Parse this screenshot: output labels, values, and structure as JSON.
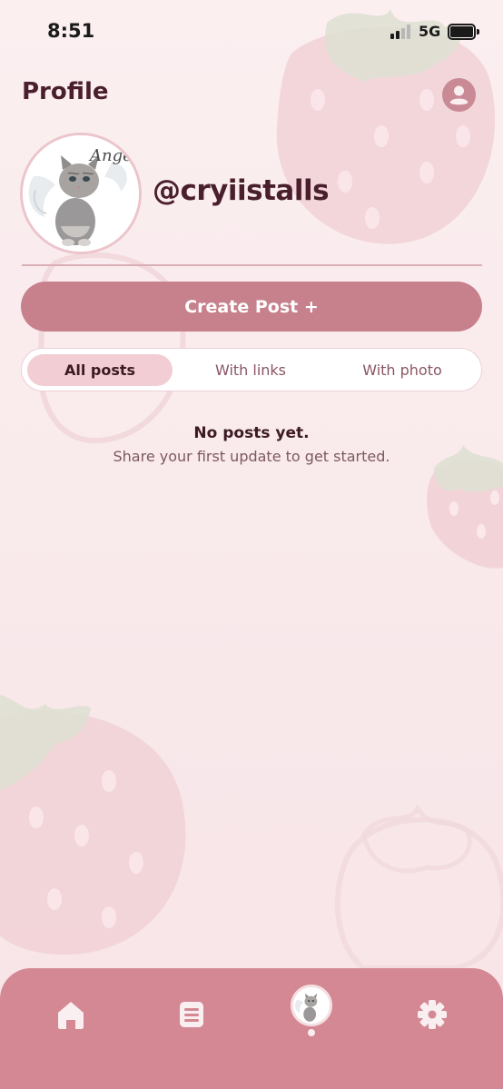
{
  "status_bar": {
    "time": "8:51",
    "network": "5G"
  },
  "header": {
    "title": "Profile",
    "account_icon": "account-circle-icon"
  },
  "profile": {
    "username": "@cryiistalls",
    "avatar_caption": "Ange"
  },
  "actions": {
    "create_post_label": "Create Post +"
  },
  "filter_tabs": {
    "active": "All posts",
    "items": [
      {
        "label": "All posts"
      },
      {
        "label": "With links"
      },
      {
        "label": "With photo"
      }
    ]
  },
  "empty_state": {
    "title": "No posts yet.",
    "subtitle": "Share your first update to get started."
  },
  "bottom_nav": {
    "items": [
      {
        "icon": "home-icon"
      },
      {
        "icon": "list-icon"
      },
      {
        "icon": "profile-avatar"
      },
      {
        "icon": "gear-icon"
      }
    ],
    "active_index": 2
  },
  "colors": {
    "accent": "#c6818c",
    "nav_bg": "#d48893",
    "title_text": "#4a1f2d",
    "tab_active_bg": "#f2cdd3"
  }
}
